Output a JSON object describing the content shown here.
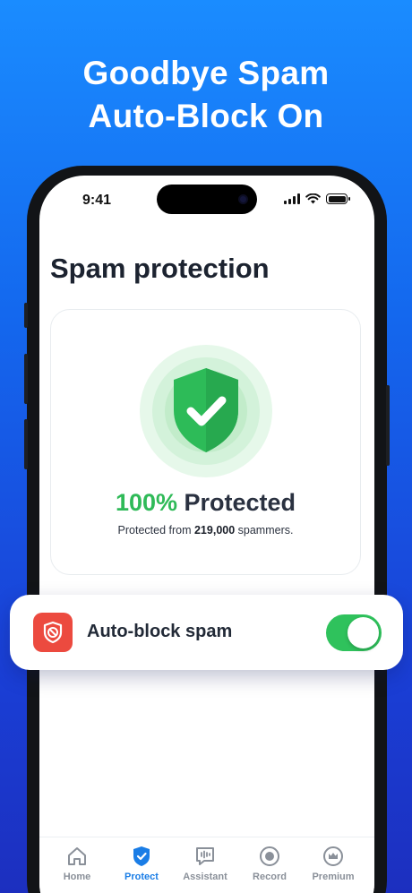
{
  "headline": {
    "line1": "Goodbye Spam",
    "line2": "Auto-Block On"
  },
  "status_bar": {
    "time": "9:41"
  },
  "page": {
    "title": "Spam protection"
  },
  "protection_card": {
    "percent": "100%",
    "status_word": "Protected",
    "sub_prefix": "Protected from",
    "sub_count": "219,000",
    "sub_suffix": "spammers."
  },
  "autoblock": {
    "label": "Auto-block spam",
    "enabled": true
  },
  "tabs": [
    {
      "label": "Home",
      "icon": "home-icon",
      "active": false
    },
    {
      "label": "Protect",
      "icon": "shield-check-icon",
      "active": true
    },
    {
      "label": "Assistant",
      "icon": "assistant-voice-icon",
      "active": false
    },
    {
      "label": "Record",
      "icon": "record-icon",
      "active": false
    },
    {
      "label": "Premium",
      "icon": "crown-icon",
      "active": false
    }
  ],
  "colors": {
    "background_top": "#1a8cff",
    "background_bottom": "#1c2fbf",
    "accent_green": "#2fba58",
    "toggle_on": "#2fc25c",
    "danger_red": "#ec4a3f",
    "active_tab": "#1a7de6"
  }
}
